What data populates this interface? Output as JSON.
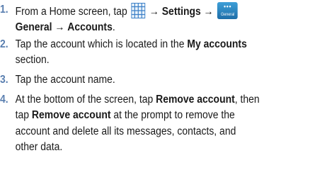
{
  "steps": [
    {
      "number": "1.",
      "parts": {
        "a": "From a Home screen, tap",
        "arrow1": "→",
        "b": "Settings",
        "arrow2": "→",
        "c": "General",
        "arrow3": "→",
        "d": "Accounts",
        "end": "."
      },
      "general_icon_label": "General",
      "general_icon_dots": "•••"
    },
    {
      "number": "2.",
      "parts": {
        "a": "Tap the account which is located in the",
        "b": "My accounts",
        "c": "section."
      }
    },
    {
      "number": "3.",
      "parts": {
        "a": "Tap the account name."
      }
    },
    {
      "number": "4.",
      "parts": {
        "a": "At the bottom of the screen, tap",
        "b": "Remove account",
        "c": ", then",
        "d": "tap",
        "e": "Remove account",
        "f": "at the prompt to remove the",
        "g": "account and delete all its messages, contacts, and",
        "h": "other data."
      }
    }
  ],
  "icons": {
    "apps": "apps-grid-icon",
    "general": "general-settings-icon"
  },
  "colors": {
    "step_number": "#5a7fb0",
    "apps_icon": "#3b7fc7",
    "general_icon": "#1e6ea8"
  }
}
